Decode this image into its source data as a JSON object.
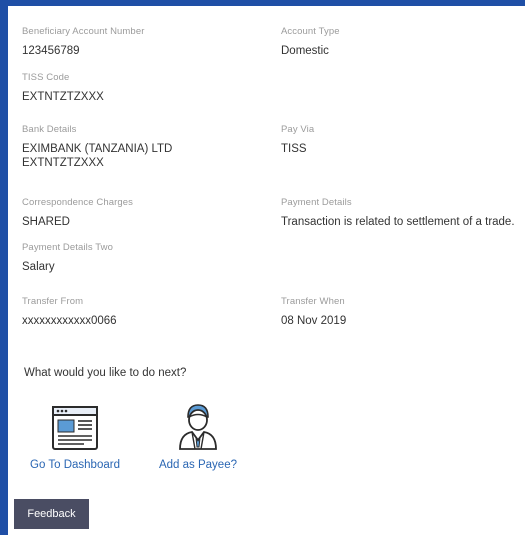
{
  "details": {
    "beneficiary_account_number": {
      "label": "Beneficiary Account Number",
      "value": "123456789"
    },
    "account_type": {
      "label": "Account Type",
      "value": "Domestic"
    },
    "tiss_code": {
      "label": "TISS Code",
      "value": "EXTNTZTZXXX"
    },
    "bank_details": {
      "label": "Bank Details",
      "line1": "EXIMBANK (TANZANIA) LTD",
      "line2": "EXTNTZTZXXX"
    },
    "pay_via": {
      "label": "Pay Via",
      "value": "TISS"
    },
    "correspondence_charges": {
      "label": "Correspondence Charges",
      "value": "SHARED"
    },
    "payment_details": {
      "label": "Payment Details",
      "value": "Transaction is related to settlement of a trade."
    },
    "payment_details_two": {
      "label": "Payment Details Two",
      "value": "Salary"
    },
    "transfer_from": {
      "label": "Transfer From",
      "value": "xxxxxxxxxxxx0066"
    },
    "transfer_when": {
      "label": "Transfer When",
      "value": "08 Nov 2019"
    }
  },
  "next_steps": {
    "question": "What would you like to do next?",
    "actions": [
      {
        "label": "Go To Dashboard",
        "icon": "dashboard-icon"
      },
      {
        "label": "Add as Payee?",
        "icon": "payee-person-icon"
      }
    ]
  },
  "feedback": {
    "label": "Feedback"
  },
  "colors": {
    "frame": "#1f4fa6",
    "link": "#2a66b3",
    "feedback_bg": "#4a4d63",
    "label_gray": "#9b9b9b"
  }
}
